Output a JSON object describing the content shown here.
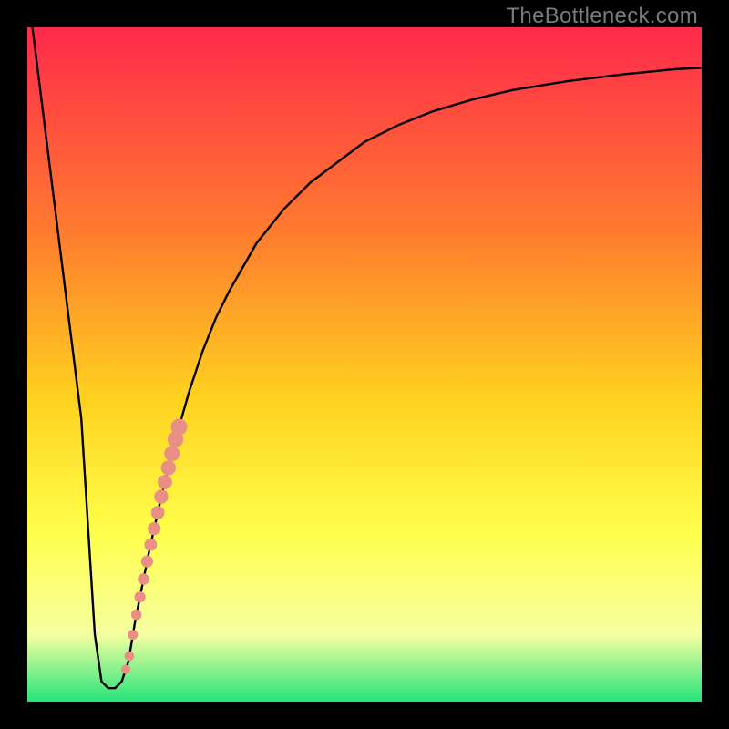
{
  "watermark": "TheBottleneck.com",
  "colors": {
    "frame": "#000000",
    "curve": "#000000",
    "dot": "#e98f86",
    "grad_top": "#ff2a4b",
    "grad_mid1": "#ff7a2f",
    "grad_mid2": "#ffd21f",
    "grad_mid3": "#ffff4c",
    "grad_mid4": "#f6ffa0",
    "grad_bottom": "#27e47a"
  },
  "chart_data": {
    "type": "line",
    "title": "",
    "xlabel": "",
    "ylabel": "",
    "xlim": [
      0,
      100
    ],
    "ylim": [
      0,
      100
    ],
    "series": [
      {
        "name": "bottleneck-curve",
        "x": [
          0,
          2,
          4,
          6,
          8,
          9,
          10,
          11,
          12,
          13,
          14,
          15,
          16,
          18,
          20,
          22,
          24,
          26,
          28,
          30,
          34,
          38,
          42,
          46,
          50,
          55,
          60,
          66,
          72,
          80,
          88,
          96,
          100
        ],
        "y": [
          106,
          90,
          74,
          58,
          42,
          26,
          10,
          3,
          2,
          2,
          3,
          6,
          12,
          22,
          31,
          39,
          46,
          52,
          57,
          61,
          68,
          73,
          77,
          80,
          83,
          85.5,
          87.5,
          89.3,
          90.7,
          92,
          93,
          93.8,
          94
        ]
      }
    ],
    "dots": {
      "name": "highlight-dots",
      "x_range": [
        14.6,
        22.5
      ],
      "y_range": [
        9,
        41
      ],
      "count_approx": 16,
      "radius_px_range": [
        5,
        9
      ]
    }
  }
}
